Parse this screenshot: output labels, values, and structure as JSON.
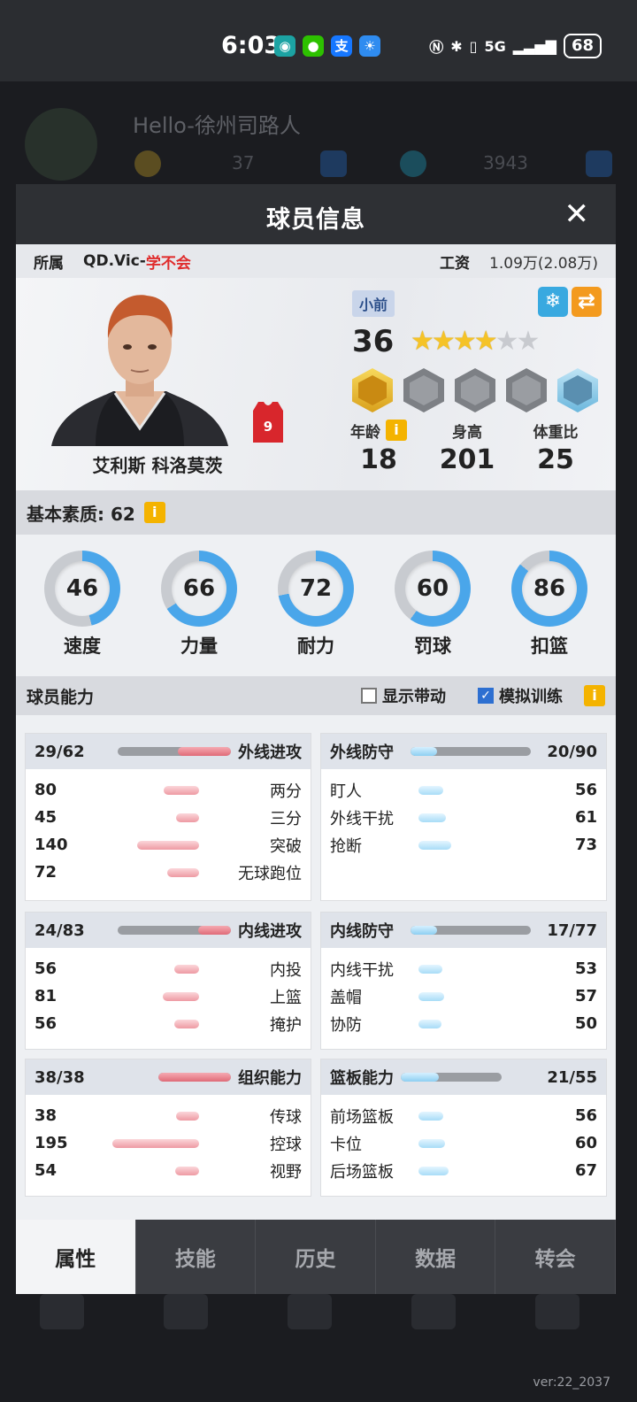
{
  "status_bar": {
    "time": "6:03",
    "network": "5G",
    "battery": "68"
  },
  "background": {
    "username": "Hello-徐州司路人",
    "currency_1": "37",
    "currency_2": "3943",
    "version": "ver:22_2037"
  },
  "modal": {
    "title": "球员信息",
    "affiliation_label": "所属",
    "team_prefix": "QD.Vic-",
    "team_suffix": "学不会",
    "salary_label": "工资",
    "salary_value": "1.09万(2.08万)"
  },
  "player": {
    "name": "艾利斯 科洛莫茨",
    "jersey_number": "9",
    "position": "小前",
    "rating": "36",
    "stars_filled": 3.5,
    "stars_total": 6,
    "age_label": "年龄",
    "age": "18",
    "height_label": "身高",
    "height": "201",
    "weight_label": "体重比",
    "weight": "25"
  },
  "basic": {
    "label": "基本素质: 62",
    "attributes": [
      {
        "label": "速度",
        "value": "46",
        "percent": 46
      },
      {
        "label": "力量",
        "value": "66",
        "percent": 66
      },
      {
        "label": "耐力",
        "value": "72",
        "percent": 72
      },
      {
        "label": "罚球",
        "value": "60",
        "percent": 60
      },
      {
        "label": "扣篮",
        "value": "86",
        "percent": 86
      }
    ]
  },
  "abilities": {
    "label": "球员能力",
    "show_drive": "显示带动",
    "sim_training": "模拟训练",
    "cards": [
      {
        "title": "外线进攻",
        "score": "29/62",
        "color": "red",
        "ratio": 0.47,
        "rows": [
          {
            "label": "两分",
            "value": "80"
          },
          {
            "label": "三分",
            "value": "45"
          },
          {
            "label": "突破",
            "value": "140"
          },
          {
            "label": "无球跑位",
            "value": "72"
          }
        ]
      },
      {
        "title": "外线防守",
        "score": "20/90",
        "color": "blue",
        "ratio": 0.22,
        "rows": [
          {
            "label": "盯人",
            "value": "56"
          },
          {
            "label": "外线干扰",
            "value": "61"
          },
          {
            "label": "抢断",
            "value": "73"
          }
        ]
      },
      {
        "title": "内线进攻",
        "score": "24/83",
        "color": "red",
        "ratio": 0.29,
        "rows": [
          {
            "label": "内投",
            "value": "56"
          },
          {
            "label": "上篮",
            "value": "81"
          },
          {
            "label": "掩护",
            "value": "56"
          }
        ]
      },
      {
        "title": "内线防守",
        "score": "17/77",
        "color": "blue",
        "ratio": 0.22,
        "rows": [
          {
            "label": "内线干扰",
            "value": "53"
          },
          {
            "label": "盖帽",
            "value": "57"
          },
          {
            "label": "协防",
            "value": "50"
          }
        ]
      },
      {
        "title": "组织能力",
        "score": "38/38",
        "color": "red",
        "ratio": 1.0,
        "rows": [
          {
            "label": "传球",
            "value": "38"
          },
          {
            "label": "控球",
            "value": "195"
          },
          {
            "label": "视野",
            "value": "54"
          }
        ]
      },
      {
        "title": "篮板能力",
        "score": "21/55",
        "color": "blue",
        "ratio": 0.38,
        "rows": [
          {
            "label": "前场篮板",
            "value": "56"
          },
          {
            "label": "卡位",
            "value": "60"
          },
          {
            "label": "后场篮板",
            "value": "67"
          }
        ]
      }
    ]
  },
  "tabs": [
    "属性",
    "技能",
    "历史",
    "数据",
    "转会"
  ],
  "colors": {
    "ring_blue": "#4aa6ea",
    "ring_gray": "#c8cbd0",
    "accent_red": "#e02c2c",
    "info_yellow": "#f4b300"
  }
}
